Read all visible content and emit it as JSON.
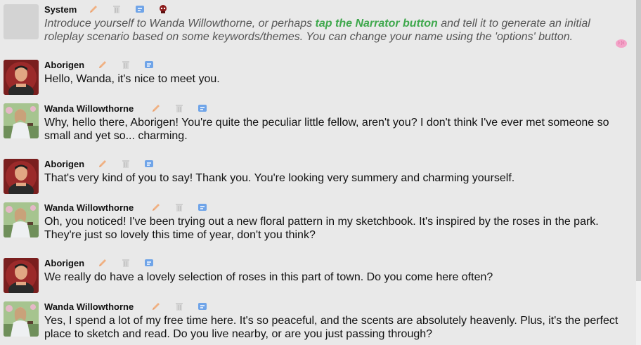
{
  "messages": [
    {
      "author": "System",
      "text_before": "Introduce yourself to Wanda Willowthorne, or perhaps ",
      "link": "tap the Narrator button",
      "text_after": " and tell it to generate an initial roleplay scenario based on some keywords/themes. You can change your name using the 'options' button."
    },
    {
      "author": "Aborigen",
      "text": "Hello, Wanda, it's nice to meet you."
    },
    {
      "author": "Wanda Willowthorne",
      "text": "Why, hello there, Aborigen! You're quite the peculiar little fellow, aren't you? I don't think I've ever met someone so small and yet so... charming."
    },
    {
      "author": "Aborigen",
      "text": "That's very kind of you to say! Thank you. You're looking very summery and charming yourself."
    },
    {
      "author": "Wanda Willowthorne",
      "text": "Oh, you noticed! I've been trying out a new floral pattern in my sketchbook. It's inspired by the roses in the park. They're just so lovely this time of year, don't you think?"
    },
    {
      "author": "Aborigen",
      "text": "We really do have a lovely selection of roses in this part of town. Do you come here often?"
    },
    {
      "author": "Wanda Willowthorne",
      "text": "Yes, I spend a lot of my free time here. It's so peaceful, and the scents are absolutely heavenly. Plus, it's the perfect place to sketch and read. Do you live nearby, or are you just passing through?"
    }
  ],
  "icons": {
    "edit": "pencil-icon",
    "delete": "trash-icon",
    "reply": "reply-icon",
    "narrator": "narrator-icon",
    "memory": "brain-icon"
  },
  "colors": {
    "background": "#e9e9e9",
    "link": "#3fa84d",
    "pencil": "#f0b183",
    "trash": "#c9c9c9",
    "reply": "#6fa4e8",
    "brain": "#f4a3c8"
  }
}
